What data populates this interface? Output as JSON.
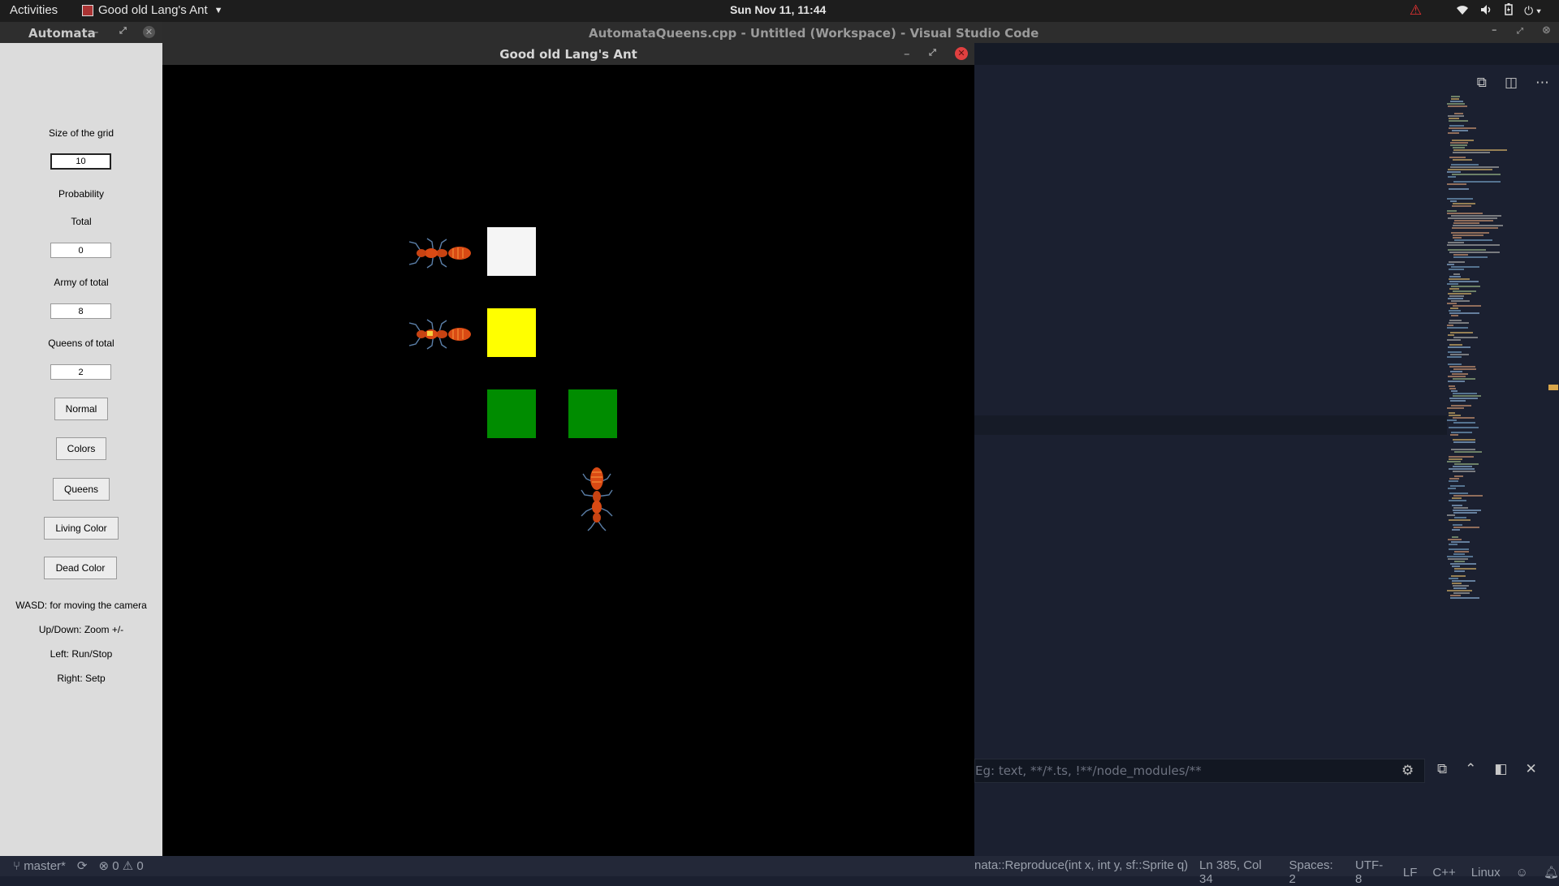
{
  "topbar": {
    "activities": "Activities",
    "app_name": "Good old Lang's Ant",
    "clock": "Sun Nov 11, 11:44"
  },
  "vscode": {
    "title": "AutomataQueens.cpp - Untitled (Workspace) - Visual Studio Code",
    "search_placeholder": "Eg: text, **/*.ts, !**/node_modules/**",
    "status": {
      "branch": "master*",
      "errors": "0",
      "warnings": "0",
      "function": "nata::Reproduce(int x, int y, sf::Sprite q)",
      "position": "Ln 385, Col 34",
      "spaces": "Spaces: 2",
      "encoding": "UTF-8",
      "eol": "LF",
      "language": "C++",
      "platform": "Linux"
    }
  },
  "automata": {
    "title": "Automata",
    "size_label": "Size of the grid",
    "size_value": "10",
    "probability_label": "Probability",
    "total_label": "Total",
    "total_value": "0",
    "army_label": "Army of total",
    "army_value": "8",
    "queens_label": "Queens of total",
    "queens_value": "2",
    "buttons": {
      "normal": "Normal",
      "colors": "Colors",
      "queens": "Queens",
      "living": "Living Color",
      "dead": "Dead Color"
    },
    "help": {
      "wasd": "WASD: for moving the camera",
      "zoom": "Up/Down: Zoom +/-",
      "left": "Left: Run/Stop",
      "right": "Right: Setp"
    }
  },
  "ant_window": {
    "title": "Good old Lang's Ant",
    "cells": [
      {
        "color": "#f5f5f5"
      },
      {
        "color": "#ffff00"
      },
      {
        "color": "#008c00"
      },
      {
        "color": "#008c00"
      }
    ]
  }
}
